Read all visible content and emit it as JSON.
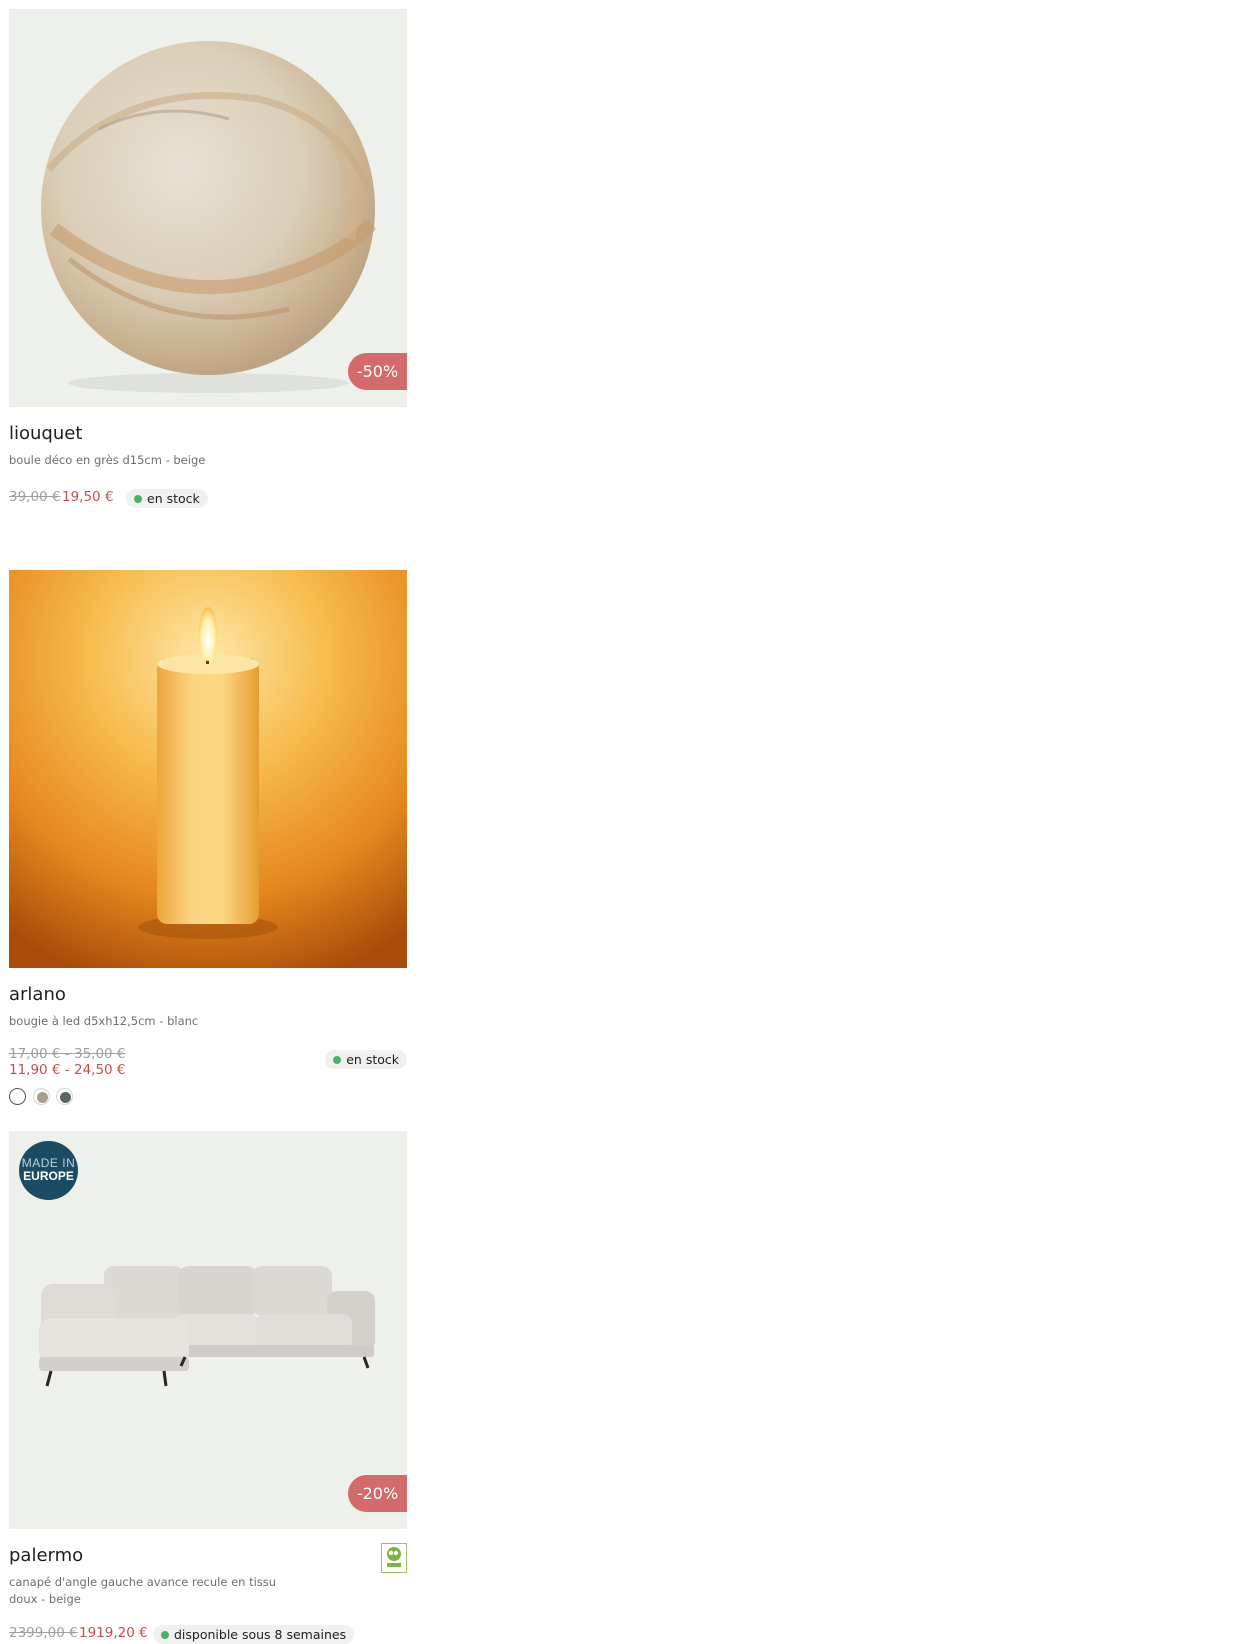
{
  "products": [
    {
      "name": "liouquet",
      "description": "boule déco en grès d15cm - beige",
      "old_price": "39,00 €",
      "new_price": "19,50 €",
      "discount": "-50%",
      "stock": "en stock",
      "image": "sandstone-sphere"
    },
    {
      "name": "arlano",
      "description": "bougie à led d5xh12,5cm - blanc",
      "old_price": "17,00 € - 35,00 €",
      "new_price": "11,90 € - 24,50 €",
      "stock": "en stock",
      "image": "led-candle",
      "swatches": [
        {
          "name": "blanc",
          "color": "#ffffff"
        },
        {
          "name": "taupe",
          "color": "#a89d8f"
        },
        {
          "name": "vert",
          "color": "#5b6660"
        }
      ]
    },
    {
      "name": "palermo",
      "description": "canapé d'angle gauche avance recule en tissu doux - beige",
      "old_price": "2399,00 €",
      "new_price": "1919,20 €",
      "discount": "-20%",
      "stock": "disponible sous 8 semaines",
      "image": "corner-sofa",
      "made_in_line1": "MADE IN",
      "made_in_line2": "EUROPE",
      "certification": "PEFC"
    }
  ],
  "colors": {
    "discount": "#d36a6c",
    "sale_price": "#c0504e",
    "stock_dot": "#4caf6a",
    "made_in_europe": "#1b4c63"
  }
}
